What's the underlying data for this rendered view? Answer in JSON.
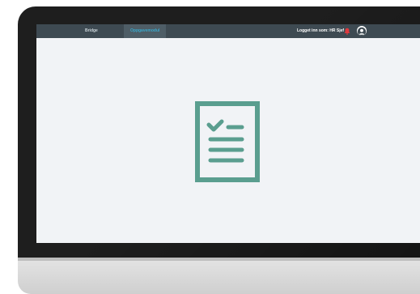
{
  "app": {
    "nav": {
      "brand": "Bridge",
      "active_tab": "Oppgavemodul"
    },
    "user": {
      "logged_in_text": "Logget inn som: HR Sjef"
    },
    "icons": {
      "notification": "bell-icon",
      "profile": "user-avatar-icon",
      "empty_state": "checklist-document-icon"
    },
    "colors": {
      "topbar": "#3e4a52",
      "accent": "#3aa6c9",
      "notification": "#e0393e",
      "empty_state_icon": "#5a9e8f",
      "screen_bg": "#f1f3f6"
    }
  }
}
